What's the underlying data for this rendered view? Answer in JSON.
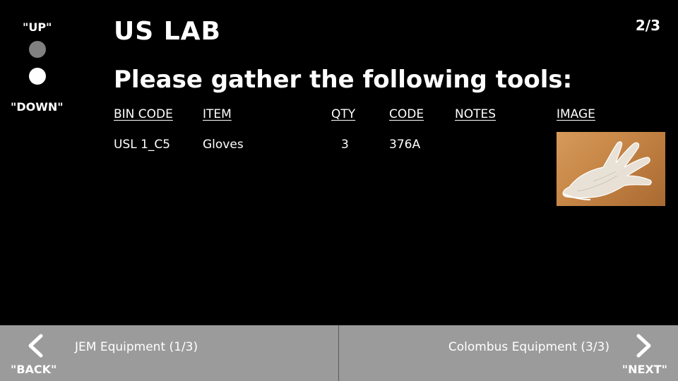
{
  "scroll": {
    "up_label": "\"UP\"",
    "down_label": "\"DOWN\""
  },
  "header": {
    "title": "US LAB",
    "page_indicator": "2/3",
    "instruction": "Please gather the following tools:"
  },
  "table": {
    "columns": [
      "BIN CODE",
      "ITEM",
      "QTY",
      "CODE",
      "NOTES",
      "IMAGE"
    ],
    "rows": [
      {
        "bin_code": "USL 1_C5",
        "item": "Gloves",
        "qty": "3",
        "code": "376A",
        "notes": "",
        "image": "gloves-photo"
      }
    ]
  },
  "footer": {
    "back": {
      "label": "JEM Equipment (1/3)",
      "voice": "\"BACK\"",
      "icon": "chevron-left-icon"
    },
    "next": {
      "label": "Colombus Equipment (3/3)",
      "voice": "\"NEXT\"",
      "icon": "chevron-right-icon"
    }
  },
  "colors": {
    "background": "#000000",
    "footer": "#9b9b9b",
    "scroll_up_dot": "#808080",
    "scroll_down_dot": "#ffffff"
  }
}
